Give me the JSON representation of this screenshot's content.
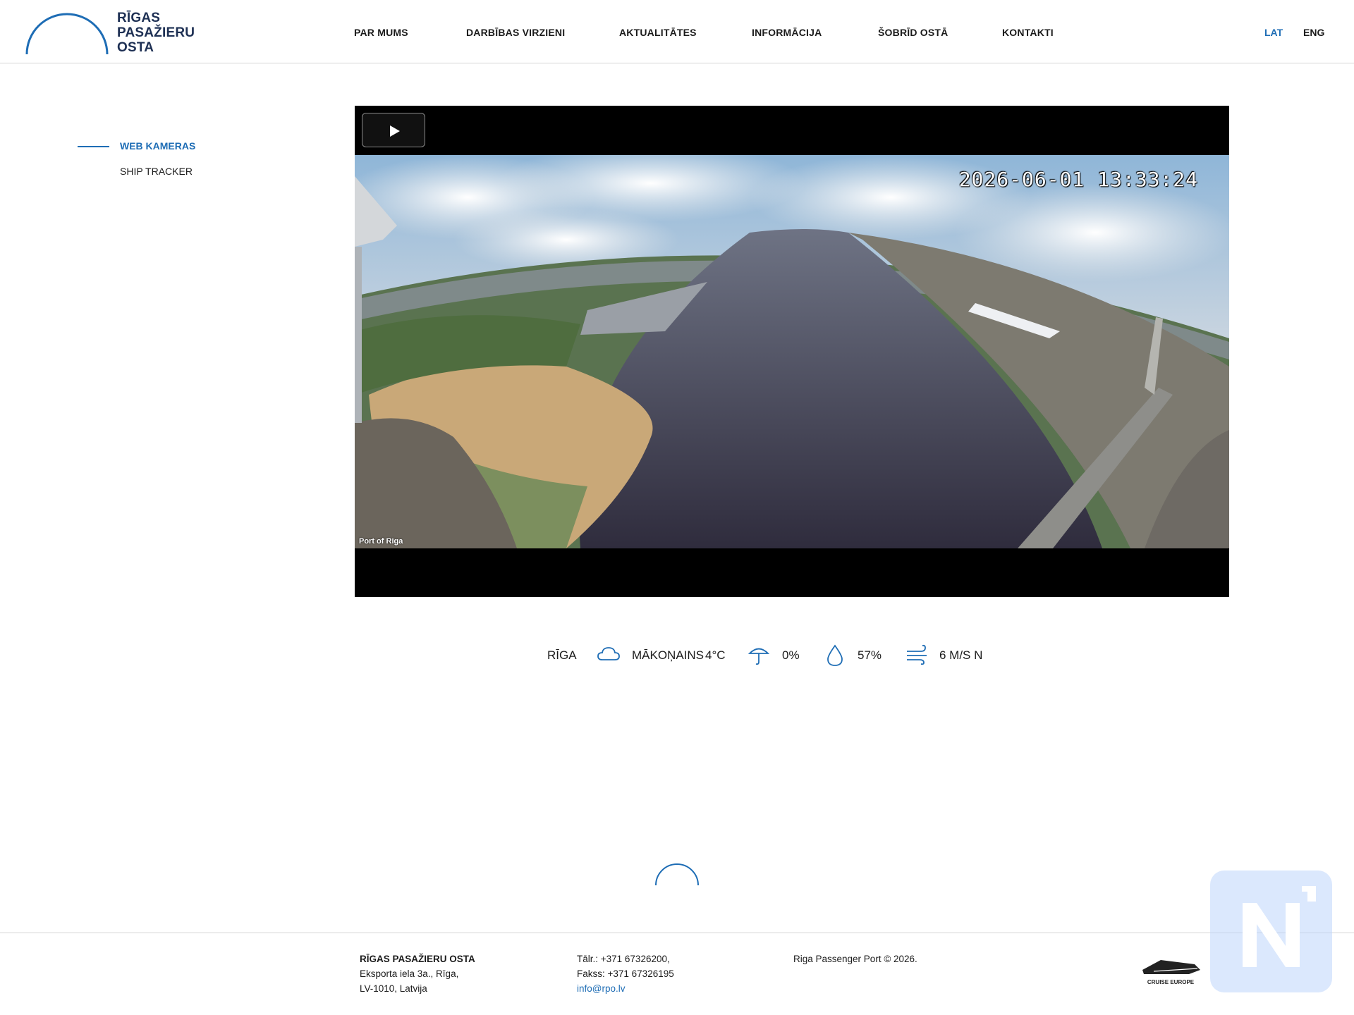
{
  "header": {
    "logo_lines": [
      "RĪGAS",
      "PASAŽIERU",
      "OSTA"
    ],
    "nav": [
      "PAR MUMS",
      "DARBĪBAS VIRZIENI",
      "AKTUALITĀTES",
      "INFORMĀCIJA",
      "ŠOBRĪD OSTĀ",
      "KONTAKTI"
    ],
    "lang": {
      "active": "LAT",
      "other": "ENG"
    }
  },
  "sidebar": {
    "items": [
      {
        "label": "WEB KAMERAS",
        "active": true
      },
      {
        "label": "SHIP TRACKER",
        "active": false
      }
    ]
  },
  "player": {
    "timestamp": "2026-06-01 13:33:24",
    "watermark": "Port of Riga",
    "play_icon": "play-icon"
  },
  "weather": {
    "city": "RĪGA",
    "condition": "MĀKOŅAINS",
    "temperature": "4°C",
    "precipitation": "0%",
    "humidity": "57%",
    "wind": "6 M/S N",
    "icons": [
      "cloud-icon",
      "umbrella-icon",
      "droplet-icon",
      "wind-icon"
    ]
  },
  "footer": {
    "company": "RĪGAS PASAŽIERU OSTA",
    "address_line1": "Eksporta iela 3a., Rīga,",
    "address_line2": "LV-1010, Latvija",
    "phone": "Tālr.: +371 67326200,",
    "fax": "Fakss: +371 67326195",
    "email": "info@rpo.lv",
    "copyright": "Riga Passenger Port © 2026.",
    "partner_logo": "CRUISE EUROPE"
  },
  "colors": {
    "accent": "#1e6db5",
    "logo_dark": "#1e3054",
    "text": "#1b1b1b"
  }
}
